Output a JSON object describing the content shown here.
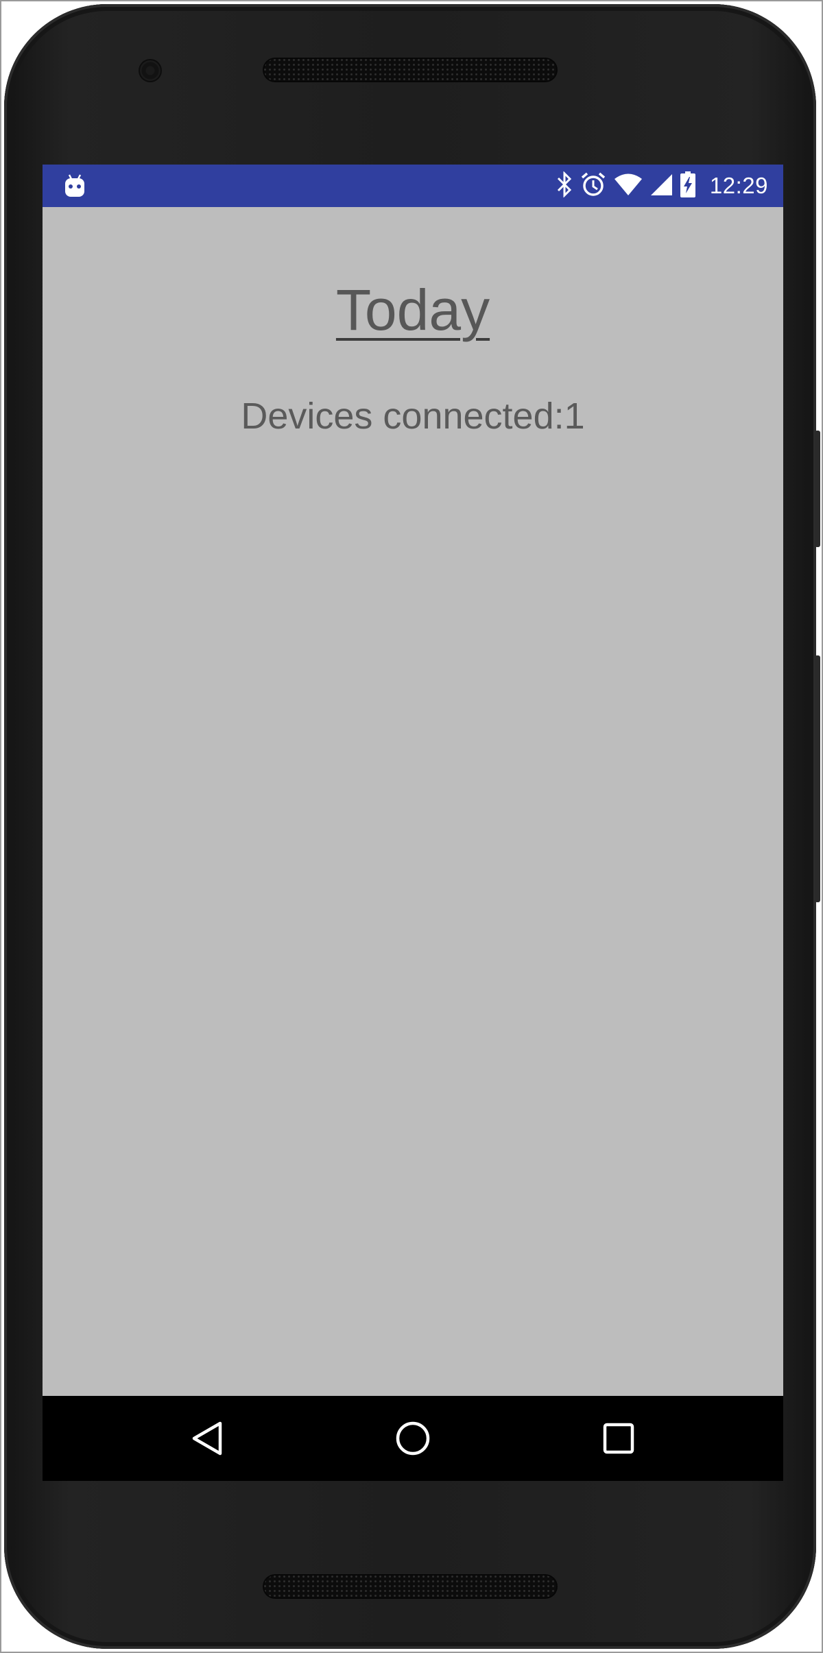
{
  "status_bar": {
    "time": "12:29",
    "notification_icon": "android-robot-icon",
    "icons": [
      "bluetooth-icon",
      "alarm-icon",
      "wifi-icon",
      "cellular-signal-icon",
      "battery-charging-icon"
    ],
    "background_color": "#303f9f"
  },
  "main": {
    "title": "Today",
    "devices_connected": "Devices connected:1",
    "background_color": "#bdbdbd"
  },
  "nav_bar": {
    "buttons": [
      "back-icon",
      "home-icon",
      "recents-icon"
    ]
  }
}
